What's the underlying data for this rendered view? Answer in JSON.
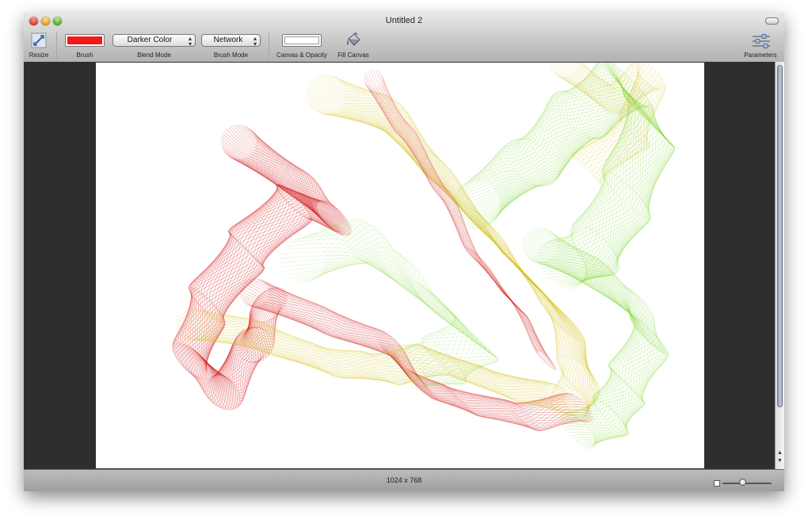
{
  "window": {
    "title": "Untitled 2"
  },
  "toolbar": {
    "resize_label": "Resize",
    "brush_label": "Brush",
    "brush_color": "#f01a1a",
    "blend_mode_value": "Darker Color",
    "blend_mode_label": "Blend Mode",
    "brush_mode_value": "Network",
    "brush_mode_label": "Brush Mode",
    "canvas_label": "Canvas & Opacity",
    "canvas_color": "#ffffff",
    "fill_canvas_label": "Fill Canvas",
    "parameters_label": "Parameters"
  },
  "status": {
    "canvas_size": "1024 x 768",
    "zoom_level": 0.4
  },
  "colors": {
    "stroke_red": "#d01010",
    "stroke_yellow": "#d4c21a",
    "stroke_green": "#6fd41a"
  }
}
